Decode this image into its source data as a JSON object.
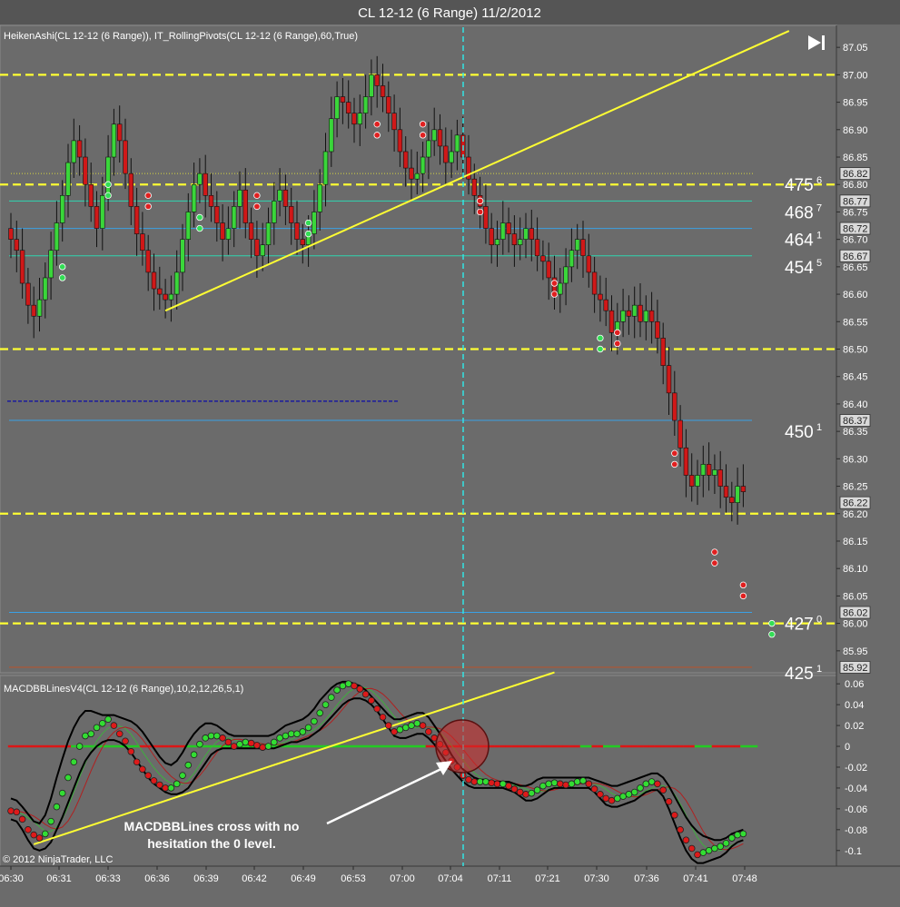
{
  "window": {
    "title": "CL 12-12 (6 Range)  11/2/2012"
  },
  "colors": {
    "background": "#6b6b6b",
    "bull": "#3ad63a",
    "bear": "#d01818",
    "pivot_dash": "#ffff33",
    "cyan": "#33e5e5",
    "macd_line": "#000000"
  },
  "nav": {
    "icon": "skip-to-end-icon"
  },
  "chart_data": [
    {
      "type": "candlestick",
      "panel": "price",
      "header": "HeikenAshi(CL 12-12 (6 Range)), IT_RollingPivots(CL 12-12 (6 Range),60,True)",
      "y_ticks": [
        "87.05",
        "87.00",
        "86.95",
        "86.90",
        "86.85",
        "86.80",
        "86.75",
        "86.70",
        "86.65",
        "86.60",
        "86.55",
        "86.50",
        "86.45",
        "86.40",
        "86.35",
        "86.30",
        "86.25",
        "86.20",
        "86.15",
        "86.10",
        "86.05",
        "86.00",
        "85.95"
      ],
      "ylim": [
        85.91,
        87.09
      ],
      "price_labels": [
        "86.82",
        "86.77",
        "86.72",
        "86.67",
        "86.37",
        "86.22",
        "86.02",
        "85.92"
      ],
      "levels": [
        {
          "price": 87.0,
          "style": "yellow-dashed"
        },
        {
          "price": 86.8,
          "style": "yellow-dashed"
        },
        {
          "price": 86.5,
          "style": "yellow-dashed"
        },
        {
          "price": 86.2,
          "style": "yellow-dashed"
        },
        {
          "price": 86.0,
          "style": "yellow-dashed"
        },
        {
          "price": 86.82,
          "style": "dotted"
        },
        {
          "price": 86.77,
          "style": "teal"
        },
        {
          "price": 86.72,
          "style": "blue"
        },
        {
          "price": 86.67,
          "style": "teal"
        },
        {
          "price": 86.37,
          "style": "blue"
        },
        {
          "price": 86.02,
          "style": "blue"
        },
        {
          "price": 85.92,
          "style": "brown"
        }
      ],
      "volume_labels": [
        {
          "main": "475",
          "sup": "6",
          "price": 86.8
        },
        {
          "main": "468",
          "sup": "7",
          "price": 86.75
        },
        {
          "main": "464",
          "sup": "1",
          "price": 86.7
        },
        {
          "main": "454",
          "sup": "5",
          "price": 86.65
        },
        {
          "main": "450",
          "sup": "1",
          "price": 86.35
        },
        {
          "main": "427",
          "sup": "0",
          "price": 86.0
        },
        {
          "main": "425",
          "sup": "1",
          "price": 85.91
        }
      ],
      "closes": [
        86.7,
        86.68,
        86.62,
        86.58,
        86.56,
        86.59,
        86.63,
        86.68,
        86.73,
        86.78,
        86.84,
        86.88,
        86.85,
        86.8,
        86.76,
        86.72,
        86.78,
        86.85,
        86.91,
        86.88,
        86.82,
        86.76,
        86.71,
        86.68,
        86.64,
        86.61,
        86.6,
        86.59,
        86.6,
        86.64,
        86.7,
        86.75,
        86.8,
        86.82,
        86.78,
        86.76,
        86.73,
        86.7,
        86.72,
        86.76,
        86.79,
        86.73,
        86.7,
        86.67,
        86.69,
        86.73,
        86.77,
        86.79,
        86.76,
        86.73,
        86.7,
        86.69,
        86.71,
        86.75,
        86.8,
        86.86,
        86.92,
        86.96,
        86.95,
        86.93,
        86.91,
        86.93,
        86.96,
        87.0,
        86.98,
        86.96,
        86.93,
        86.9,
        86.86,
        86.83,
        86.81,
        86.82,
        86.85,
        86.88,
        86.9,
        86.87,
        86.84,
        86.86,
        86.89,
        86.85,
        86.81,
        86.78,
        86.76,
        86.72,
        86.69,
        86.7,
        86.73,
        86.71,
        86.69,
        86.7,
        86.72,
        86.7,
        86.67,
        86.66,
        86.63,
        86.6,
        86.62,
        86.65,
        86.68,
        86.7,
        86.67,
        86.64,
        86.6,
        86.59,
        86.57,
        86.53,
        86.55,
        86.57,
        86.56,
        86.58,
        86.55,
        86.57,
        86.55,
        86.52,
        86.47,
        86.42,
        86.37,
        86.32,
        86.27,
        86.25,
        86.27,
        86.29,
        86.27,
        86.28,
        86.25,
        86.23,
        86.22,
        86.25,
        86.24
      ],
      "ha_dots": [
        {
          "i": 9,
          "price": 86.65,
          "color": "green"
        },
        {
          "i": 9,
          "price": 86.63,
          "color": "green"
        },
        {
          "i": 17,
          "price": 86.8,
          "color": "green"
        },
        {
          "i": 17,
          "price": 86.78,
          "color": "green"
        },
        {
          "i": 24,
          "price": 86.78,
          "color": "red"
        },
        {
          "i": 24,
          "price": 86.76,
          "color": "red"
        },
        {
          "i": 33,
          "price": 86.74,
          "color": "green"
        },
        {
          "i": 33,
          "price": 86.72,
          "color": "green"
        },
        {
          "i": 43,
          "price": 86.78,
          "color": "red"
        },
        {
          "i": 43,
          "price": 86.76,
          "color": "red"
        },
        {
          "i": 52,
          "price": 86.73,
          "color": "green"
        },
        {
          "i": 52,
          "price": 86.71,
          "color": "green"
        },
        {
          "i": 64,
          "price": 86.91,
          "color": "red"
        },
        {
          "i": 64,
          "price": 86.89,
          "color": "red"
        },
        {
          "i": 72,
          "price": 86.91,
          "color": "red"
        },
        {
          "i": 72,
          "price": 86.89,
          "color": "red"
        },
        {
          "i": 82,
          "price": 86.77,
          "color": "red"
        },
        {
          "i": 82,
          "price": 86.75,
          "color": "red"
        },
        {
          "i": 95,
          "price": 86.62,
          "color": "red"
        },
        {
          "i": 95,
          "price": 86.6,
          "color": "red"
        },
        {
          "i": 103,
          "price": 86.52,
          "color": "green"
        },
        {
          "i": 103,
          "price": 86.5,
          "color": "green"
        },
        {
          "i": 106,
          "price": 86.53,
          "color": "red"
        },
        {
          "i": 106,
          "price": 86.51,
          "color": "red"
        },
        {
          "i": 116,
          "price": 86.31,
          "color": "red"
        },
        {
          "i": 116,
          "price": 86.29,
          "color": "red"
        },
        {
          "i": 123,
          "price": 86.13,
          "color": "red"
        },
        {
          "i": 123,
          "price": 86.11,
          "color": "red"
        },
        {
          "i": 128,
          "price": 86.07,
          "color": "red"
        },
        {
          "i": 128,
          "price": 86.05,
          "color": "red"
        },
        {
          "i": 133,
          "price": 86.0,
          "color": "green"
        },
        {
          "i": 133,
          "price": 85.98,
          "color": "green"
        }
      ],
      "trendline": [
        {
          "i": 27,
          "price": 86.57
        },
        {
          "i": 136,
          "price": 87.08
        }
      ]
    },
    {
      "type": "line",
      "panel": "macd",
      "header": "MACDBBLinesV4(CL 12-12 (6 Range),10,2,12,26,5,1)",
      "y_ticks": [
        "0.06",
        "0.04",
        "0.02",
        "0",
        "-0.02",
        "-0.04",
        "-0.06",
        "-0.08",
        "-0.1"
      ],
      "ylim": [
        -0.115,
        0.068
      ],
      "x_ticks": [
        "06:30",
        "06:31",
        "06:33",
        "06:36",
        "06:39",
        "06:42",
        "06:49",
        "06:53",
        "07:00",
        "07:04",
        "07:11",
        "07:21",
        "07:30",
        "07:36",
        "07:41",
        "07:48"
      ],
      "macd": [
        -0.062,
        -0.063,
        -0.07,
        -0.08,
        -0.085,
        -0.088,
        -0.084,
        -0.072,
        -0.058,
        -0.045,
        -0.03,
        -0.015,
        0.0,
        0.01,
        0.012,
        0.018,
        0.022,
        0.026,
        0.02,
        0.012,
        0.005,
        -0.005,
        -0.015,
        -0.022,
        -0.028,
        -0.033,
        -0.037,
        -0.04,
        -0.04,
        -0.036,
        -0.028,
        -0.018,
        -0.008,
        0.002,
        0.008,
        0.01,
        0.01,
        0.008,
        0.004,
        0.0,
        0.002,
        0.004,
        0.003,
        0.001,
        -0.001,
        0.0,
        0.004,
        0.008,
        0.01,
        0.012,
        0.012,
        0.014,
        0.018,
        0.024,
        0.032,
        0.04,
        0.047,
        0.054,
        0.058,
        0.06,
        0.058,
        0.055,
        0.05,
        0.044,
        0.036,
        0.028,
        0.02,
        0.014,
        0.016,
        0.018,
        0.02,
        0.022,
        0.02,
        0.014,
        0.008,
        0.002,
        -0.006,
        -0.014,
        -0.02,
        -0.028,
        -0.032,
        -0.034,
        -0.034,
        -0.034,
        -0.035,
        -0.036,
        -0.036,
        -0.038,
        -0.041,
        -0.044,
        -0.046,
        -0.045,
        -0.042,
        -0.038,
        -0.036,
        -0.035,
        -0.036,
        -0.037,
        -0.036,
        -0.034,
        -0.033,
        -0.036,
        -0.041,
        -0.046,
        -0.05,
        -0.052,
        -0.05,
        -0.048,
        -0.046,
        -0.044,
        -0.04,
        -0.036,
        -0.034,
        -0.036,
        -0.042,
        -0.053,
        -0.066,
        -0.08,
        -0.09,
        -0.098,
        -0.104,
        -0.102,
        -0.1,
        -0.098,
        -0.096,
        -0.093,
        -0.088,
        -0.085,
        -0.084
      ],
      "bb_upper": [
        -0.05,
        -0.052,
        -0.058,
        -0.065,
        -0.072,
        -0.074,
        -0.066,
        -0.05,
        -0.03,
        -0.012,
        0.005,
        0.018,
        0.028,
        0.034,
        0.034,
        0.032,
        0.03,
        0.03,
        0.03,
        0.028,
        0.026,
        0.024,
        0.02,
        0.014,
        0.006,
        -0.002,
        -0.01,
        -0.016,
        -0.018,
        -0.014,
        -0.006,
        0.004,
        0.012,
        0.018,
        0.022,
        0.022,
        0.02,
        0.016,
        0.012,
        0.01,
        0.01,
        0.01,
        0.01,
        0.01,
        0.01,
        0.01,
        0.012,
        0.016,
        0.02,
        0.022,
        0.024,
        0.026,
        0.03,
        0.036,
        0.044,
        0.05,
        0.056,
        0.06,
        0.062,
        0.062,
        0.06,
        0.058,
        0.054,
        0.048,
        0.042,
        0.036,
        0.03,
        0.026,
        0.026,
        0.028,
        0.03,
        0.032,
        0.032,
        0.028,
        0.02,
        0.012,
        0.002,
        -0.008,
        -0.016,
        -0.022,
        -0.026,
        -0.03,
        -0.032,
        -0.032,
        -0.034,
        -0.034,
        -0.034,
        -0.034,
        -0.036,
        -0.038,
        -0.038,
        -0.036,
        -0.032,
        -0.03,
        -0.03,
        -0.03,
        -0.03,
        -0.03,
        -0.03,
        -0.03,
        -0.03,
        -0.03,
        -0.032,
        -0.034,
        -0.036,
        -0.038,
        -0.038,
        -0.036,
        -0.034,
        -0.032,
        -0.03,
        -0.028,
        -0.026,
        -0.026,
        -0.03,
        -0.038,
        -0.048,
        -0.058,
        -0.068,
        -0.076,
        -0.082,
        -0.086,
        -0.088,
        -0.09,
        -0.09,
        -0.088,
        -0.084,
        -0.082,
        -0.08
      ],
      "bb_lower": [
        -0.07,
        -0.072,
        -0.08,
        -0.09,
        -0.098,
        -0.1,
        -0.098,
        -0.092,
        -0.08,
        -0.068,
        -0.054,
        -0.04,
        -0.026,
        -0.014,
        -0.006,
        0.0,
        0.004,
        0.006,
        0.006,
        0.004,
        0.0,
        -0.006,
        -0.014,
        -0.022,
        -0.03,
        -0.036,
        -0.04,
        -0.044,
        -0.046,
        -0.046,
        -0.044,
        -0.04,
        -0.032,
        -0.024,
        -0.016,
        -0.008,
        -0.004,
        -0.002,
        -0.002,
        -0.002,
        -0.002,
        -0.002,
        -0.002,
        -0.002,
        -0.002,
        -0.002,
        -0.002,
        0.0,
        0.002,
        0.004,
        0.004,
        0.006,
        0.008,
        0.012,
        0.016,
        0.022,
        0.028,
        0.034,
        0.04,
        0.044,
        0.046,
        0.046,
        0.044,
        0.04,
        0.034,
        0.026,
        0.018,
        0.01,
        0.008,
        0.008,
        0.01,
        0.012,
        0.012,
        0.008,
        0.002,
        -0.006,
        -0.014,
        -0.022,
        -0.028,
        -0.034,
        -0.038,
        -0.04,
        -0.04,
        -0.04,
        -0.04,
        -0.04,
        -0.04,
        -0.042,
        -0.044,
        -0.048,
        -0.052,
        -0.052,
        -0.05,
        -0.046,
        -0.042,
        -0.04,
        -0.04,
        -0.04,
        -0.04,
        -0.04,
        -0.04,
        -0.04,
        -0.044,
        -0.05,
        -0.056,
        -0.058,
        -0.058,
        -0.056,
        -0.054,
        -0.052,
        -0.048,
        -0.044,
        -0.042,
        -0.042,
        -0.048,
        -0.06,
        -0.074,
        -0.088,
        -0.1,
        -0.108,
        -0.112,
        -0.112,
        -0.11,
        -0.108,
        -0.106,
        -0.102,
        -0.096,
        -0.092,
        -0.09
      ],
      "zero_line_colors": [
        "red",
        "red",
        "red",
        "red",
        "red",
        "red",
        "red",
        "red",
        "red",
        "red",
        "red",
        "green",
        "green",
        "green",
        "green",
        "green",
        "green",
        "green",
        "green",
        "green",
        "green",
        "green",
        "green",
        "red",
        "red",
        "red",
        "red",
        "red",
        "red",
        "red",
        "red",
        "green",
        "green",
        "green",
        "green",
        "green",
        "green",
        "green",
        "green",
        "green",
        "green",
        "green",
        "green",
        "green",
        "green",
        "green",
        "green",
        "green",
        "green",
        "green",
        "green",
        "green",
        "green",
        "green",
        "green",
        "green",
        "green",
        "green",
        "green",
        "green",
        "green",
        "green",
        "green",
        "green",
        "green",
        "green",
        "green",
        "green",
        "green",
        "green",
        "green",
        "green",
        "green",
        "red",
        "red",
        "red",
        "red",
        "red",
        "red",
        "red",
        "red",
        "red",
        "red",
        "red",
        "red",
        "red",
        "red",
        "red",
        "red",
        "red",
        "red",
        "red",
        "red",
        "red",
        "red",
        "red",
        "red",
        "red",
        "red",
        "red",
        "green",
        "green",
        "red",
        "red",
        "green",
        "green",
        "green",
        "red",
        "red",
        "red",
        "red",
        "red",
        "red",
        "red",
        "red",
        "red",
        "red",
        "red",
        "red",
        "red",
        "green",
        "green",
        "green",
        "red",
        "red",
        "red",
        "red",
        "red",
        "green",
        "green",
        "green"
      ],
      "trendline": [
        {
          "i": 4,
          "value": -0.094
        },
        {
          "i": 95,
          "value": 0.071
        }
      ],
      "annotation": "MACDBBLines cross with no hesitation the 0 level.",
      "annotation_lines": [
        "MACDBBLines cross with no",
        "hesitation the 0 level."
      ]
    }
  ],
  "footer": {
    "copyright": "© 2012 NinjaTrader, LLC"
  }
}
